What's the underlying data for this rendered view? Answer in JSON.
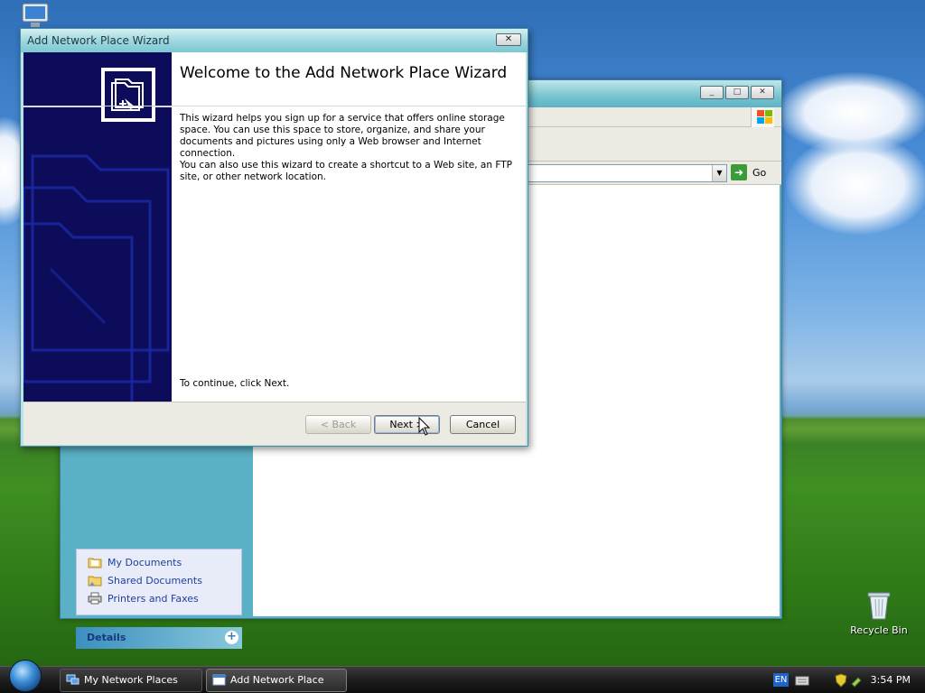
{
  "desktop": {
    "icons": [
      {
        "label": "Recycle Bin"
      }
    ]
  },
  "explorer": {
    "title": "My Network Places",
    "go_label": "Go",
    "tasks": [
      {
        "label": "My Documents"
      },
      {
        "label": "Shared Documents"
      },
      {
        "label": "Printers and Faxes"
      }
    ],
    "details_label": "Details"
  },
  "wizard": {
    "title": "Add Network Place Wizard",
    "close_label": "✕",
    "heading": "Welcome to the Add Network Place Wizard",
    "para1": "This wizard helps you sign up for a service that offers online storage space. You can use this space to store, organize, and share your documents and pictures using only a Web browser and Internet connection.",
    "para2": "You can also use this wizard to create a shortcut to a Web site, an FTP site, or other network location.",
    "continue_text": "To continue, click Next.",
    "back_label": "< Back",
    "next_label": "Next >",
    "cancel_label": "Cancel"
  },
  "taskbar": {
    "items": [
      {
        "label": "My Network Places"
      },
      {
        "label": "Add Network Place Wi..."
      }
    ],
    "language": "EN",
    "clock": "3:54 PM"
  },
  "colors": {
    "wizard_banner": "#0c0c5a",
    "title_bar": "#9bd6de",
    "link": "#1d3ea3"
  }
}
